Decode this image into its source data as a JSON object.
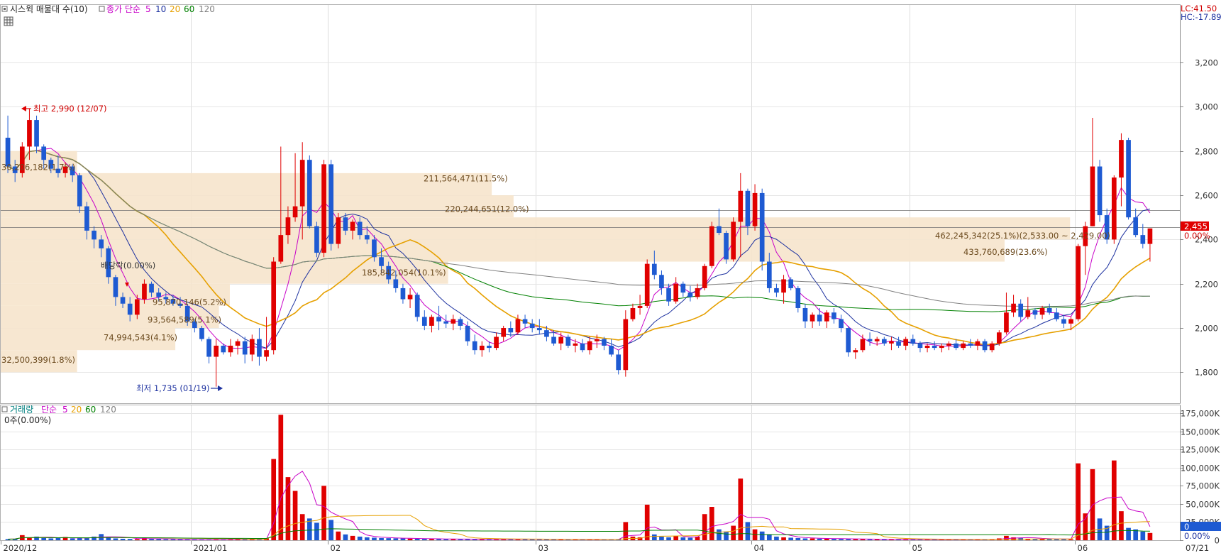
{
  "legend_price": {
    "indicator": "시스윅 매물대 수(10)",
    "ma_label": "종가 단순",
    "periods": [
      "5",
      "10",
      "20",
      "60",
      "120"
    ],
    "colors": [
      "#c800c8",
      "#1e32a0",
      "#e6a000",
      "#008000",
      "#808080"
    ]
  },
  "legend_volume": {
    "label": "거래량",
    "ma_label": "단순",
    "periods": [
      "5",
      "20",
      "60",
      "120"
    ],
    "colors": [
      "#c800c8",
      "#e6a000",
      "#008000",
      "#808080"
    ],
    "summary": "0주(0.00%)"
  },
  "corner": {
    "lc": "LC:41.50",
    "hc": "HC:-17.89"
  },
  "price_badge": {
    "value": "2,455",
    "pct": "0.00%"
  },
  "volume_badge": {
    "value": "0",
    "pct": "0.00%"
  },
  "annotations": {
    "high": "최고 2,990 (12/07)",
    "low": "최저 1,735 (01/19)",
    "dividend": "배당락(0.00%)"
  },
  "chart_data": {
    "type": "candlestick",
    "date_range": [
      "2020-12",
      "2021-07-21"
    ],
    "x_tick_labels": [
      "2020/12",
      "2021/01",
      "02",
      "03",
      "04",
      "05",
      "06",
      "07",
      "07/21"
    ],
    "price_axis": {
      "ylim": [
        1660,
        3460
      ],
      "ticks": [
        1800,
        2000,
        2200,
        2400,
        2600,
        2800,
        3000,
        3200
      ],
      "tick_labels": [
        "1,800",
        "2,000",
        "2,200",
        "2,400",
        "2,600",
        "2,800",
        "3,000",
        "3,200"
      ]
    },
    "volume_axis": {
      "ylim": [
        0,
        186000
      ],
      "ticks": [
        0,
        25000,
        50000,
        75000,
        100000,
        125000,
        150000,
        175000
      ],
      "tick_labels": [
        "0",
        "25,000K",
        "50,000K",
        "75,000K",
        "100,000K",
        "125,000K",
        "150,000K",
        "175,000K"
      ]
    },
    "volume_profile": [
      {
        "low": 1800,
        "high": 1900,
        "label": "32,500,399(1.8%)"
      },
      {
        "low": 1900,
        "high": 2000,
        "label": "74,994,543(4.1%)"
      },
      {
        "low": 2000,
        "high": 2100,
        "label": "93,564,589(5.1%)"
      },
      {
        "low": 2100,
        "high": 2200,
        "label": "95,870,146(5.2%)"
      },
      {
        "low": 2200,
        "high": 2300,
        "label": "185,842,054(10.1%)"
      },
      {
        "low": 2300,
        "high": 2400,
        "label": "433,760,689(23.6%)"
      },
      {
        "low": 2400,
        "high": 2500,
        "label": "462,245,342(25.1%)(2,533.00 ~ 2,429.00)"
      },
      {
        "low": 2500,
        "high": 2600,
        "label": "220,244,651(12.0%)"
      },
      {
        "low": 2600,
        "high": 2700,
        "label": "211,564,471(11.5%)"
      },
      {
        "low": 2700,
        "high": 2800,
        "label": "30,206,182(1.7%)"
      }
    ],
    "reference_lines": [
      2455,
      2533
    ],
    "candles": [
      [
        2860,
        2960,
        2700,
        2730,
        1500
      ],
      [
        2730,
        2760,
        2660,
        2700,
        2000
      ],
      [
        2700,
        2840,
        2680,
        2820,
        7000
      ],
      [
        2820,
        2990,
        2760,
        2940,
        3500
      ],
      [
        2940,
        2960,
        2790,
        2820,
        5000
      ],
      [
        2820,
        2830,
        2720,
        2760,
        3000
      ],
      [
        2760,
        2770,
        2700,
        2720,
        2500
      ],
      [
        2720,
        2780,
        2680,
        2700,
        3000
      ],
      [
        2700,
        2750,
        2680,
        2730,
        4500
      ],
      [
        2730,
        2740,
        2660,
        2690,
        2500
      ],
      [
        2690,
        2700,
        2520,
        2550,
        3000
      ],
      [
        2550,
        2570,
        2400,
        2440,
        3000
      ],
      [
        2440,
        2460,
        2360,
        2400,
        5000
      ],
      [
        2400,
        2420,
        2320,
        2360,
        8500
      ],
      [
        2360,
        2370,
        2200,
        2230,
        4000
      ],
      [
        2230,
        2240,
        2100,
        2140,
        2500
      ],
      [
        2140,
        2160,
        2090,
        2110,
        2000
      ],
      [
        2110,
        2140,
        2030,
        2060,
        1800
      ],
      [
        2060,
        2150,
        2040,
        2130,
        1500
      ],
      [
        2130,
        2220,
        2110,
        2200,
        3000
      ],
      [
        2200,
        2210,
        2140,
        2160,
        2000
      ],
      [
        2160,
        2180,
        2120,
        2140,
        1500
      ],
      [
        2140,
        2160,
        2110,
        2130,
        1200
      ],
      [
        2130,
        2150,
        2100,
        2110,
        1200
      ],
      [
        2110,
        2140,
        2090,
        2100,
        1000
      ],
      [
        2100,
        2110,
        2010,
        2030,
        900
      ],
      [
        2030,
        2040,
        1980,
        2000,
        900
      ],
      [
        2000,
        2010,
        1940,
        1950,
        800
      ],
      [
        1950,
        1960,
        1840,
        1870,
        900
      ],
      [
        1870,
        1950,
        1735,
        1920,
        1200
      ],
      [
        1920,
        1930,
        1880,
        1890,
        800
      ],
      [
        1890,
        1950,
        1870,
        1920,
        1500
      ],
      [
        1920,
        1950,
        1880,
        1940,
        1300
      ],
      [
        1940,
        1960,
        1840,
        1880,
        1000
      ],
      [
        1880,
        1970,
        1850,
        1950,
        1200
      ],
      [
        1950,
        2000,
        1830,
        1870,
        1500
      ],
      [
        1870,
        2050,
        1850,
        1900,
        2500
      ],
      [
        1900,
        2320,
        1880,
        2300,
        112000
      ],
      [
        2300,
        2820,
        2290,
        2420,
        173000
      ],
      [
        2420,
        2550,
        2380,
        2500,
        87000
      ],
      [
        2500,
        2790,
        2480,
        2550,
        68000
      ],
      [
        2550,
        2840,
        2400,
        2760,
        36000
      ],
      [
        2760,
        2780,
        2450,
        2460,
        30000
      ],
      [
        2460,
        2480,
        2320,
        2340,
        24000
      ],
      [
        2340,
        2760,
        2320,
        2740,
        75000
      ],
      [
        2740,
        2760,
        2350,
        2380,
        28000
      ],
      [
        2380,
        2520,
        2360,
        2500,
        12000
      ],
      [
        2500,
        2520,
        2420,
        2440,
        8000
      ],
      [
        2440,
        2490,
        2400,
        2480,
        6000
      ],
      [
        2480,
        2500,
        2400,
        2420,
        5000
      ],
      [
        2420,
        2460,
        2380,
        2400,
        4000
      ],
      [
        2400,
        2420,
        2300,
        2320,
        3500
      ],
      [
        2320,
        2360,
        2250,
        2280,
        3000
      ],
      [
        2280,
        2300,
        2200,
        2220,
        2800
      ],
      [
        2220,
        2260,
        2160,
        2180,
        2600
      ],
      [
        2180,
        2200,
        2110,
        2130,
        2400
      ],
      [
        2130,
        2180,
        2090,
        2150,
        2200
      ],
      [
        2150,
        2160,
        2030,
        2050,
        2000
      ],
      [
        2050,
        2080,
        1990,
        2010,
        1900
      ],
      [
        2010,
        2060,
        1980,
        2050,
        1800
      ],
      [
        2050,
        2100,
        1990,
        2030,
        1700
      ],
      [
        2030,
        2060,
        2000,
        2020,
        1600
      ],
      [
        2020,
        2060,
        1990,
        2040,
        1500
      ],
      [
        2040,
        2050,
        1990,
        2010,
        1400
      ],
      [
        2010,
        2030,
        1920,
        1940,
        1500
      ],
      [
        1940,
        1970,
        1880,
        1900,
        1300
      ],
      [
        1900,
        1940,
        1870,
        1920,
        1200
      ],
      [
        1920,
        1940,
        1890,
        1910,
        1100
      ],
      [
        1910,
        1980,
        1900,
        1960,
        1200
      ],
      [
        1960,
        2010,
        1940,
        2000,
        1400
      ],
      [
        2000,
        2030,
        1960,
        1980,
        1300
      ],
      [
        1980,
        2060,
        1970,
        2040,
        1500
      ],
      [
        2040,
        2060,
        2000,
        2020,
        1300
      ],
      [
        2020,
        2040,
        1980,
        2000,
        1200
      ],
      [
        2000,
        2040,
        1970,
        1990,
        1100
      ],
      [
        1990,
        2010,
        1940,
        1960,
        1000
      ],
      [
        1960,
        1990,
        1920,
        1930,
        1000
      ],
      [
        1930,
        1980,
        1900,
        1960,
        1000
      ],
      [
        1960,
        1970,
        1910,
        1920,
        900
      ],
      [
        1920,
        1950,
        1890,
        1930,
        900
      ],
      [
        1930,
        1950,
        1890,
        1900,
        800
      ],
      [
        1900,
        1960,
        1880,
        1940,
        900
      ],
      [
        1940,
        1970,
        1910,
        1950,
        900
      ],
      [
        1950,
        1960,
        1900,
        1920,
        800
      ],
      [
        1920,
        1950,
        1870,
        1880,
        900
      ],
      [
        1880,
        1900,
        1790,
        1810,
        1200
      ],
      [
        1810,
        2080,
        1780,
        2040,
        25000
      ],
      [
        2040,
        2110,
        2030,
        2090,
        5000
      ],
      [
        2090,
        2150,
        2060,
        2100,
        4000
      ],
      [
        2100,
        2310,
        2090,
        2290,
        49000
      ],
      [
        2290,
        2350,
        2220,
        2240,
        8000
      ],
      [
        2240,
        2260,
        2150,
        2180,
        5000
      ],
      [
        2180,
        2200,
        2100,
        2120,
        4000
      ],
      [
        2120,
        2230,
        2110,
        2200,
        6000
      ],
      [
        2200,
        2210,
        2140,
        2160,
        4000
      ],
      [
        2160,
        2190,
        2120,
        2140,
        3500
      ],
      [
        2140,
        2200,
        2130,
        2180,
        5000
      ],
      [
        2180,
        2290,
        2170,
        2280,
        36000
      ],
      [
        2280,
        2480,
        2270,
        2460,
        46000
      ],
      [
        2460,
        2540,
        2420,
        2430,
        15000
      ],
      [
        2430,
        2440,
        2290,
        2310,
        12000
      ],
      [
        2310,
        2500,
        2300,
        2480,
        20000
      ],
      [
        2480,
        2700,
        2320,
        2620,
        85000
      ],
      [
        2620,
        2630,
        2420,
        2460,
        25000
      ],
      [
        2460,
        2650,
        2440,
        2610,
        15000
      ],
      [
        2610,
        2630,
        2260,
        2300,
        12000
      ],
      [
        2300,
        2340,
        2160,
        2180,
        8000
      ],
      [
        2180,
        2200,
        2140,
        2160,
        5000
      ],
      [
        2160,
        2240,
        2110,
        2220,
        4000
      ],
      [
        2220,
        2230,
        2170,
        2180,
        3500
      ],
      [
        2180,
        2190,
        2070,
        2090,
        3000
      ],
      [
        2090,
        2110,
        2000,
        2030,
        2500
      ],
      [
        2030,
        2070,
        2000,
        2060,
        2500
      ],
      [
        2060,
        2090,
        2010,
        2030,
        2200
      ],
      [
        2030,
        2080,
        2000,
        2070,
        2200
      ],
      [
        2070,
        2090,
        2020,
        2040,
        2000
      ],
      [
        2040,
        2060,
        1980,
        2000,
        1800
      ],
      [
        2000,
        2010,
        1870,
        1890,
        1800
      ],
      [
        1890,
        1910,
        1860,
        1900,
        1500
      ],
      [
        1900,
        1970,
        1890,
        1950,
        1500
      ],
      [
        1950,
        1980,
        1920,
        1940,
        1400
      ],
      [
        1940,
        1960,
        1920,
        1950,
        1300
      ],
      [
        1950,
        1960,
        1920,
        1930,
        1200
      ],
      [
        1930,
        1960,
        1900,
        1940,
        1200
      ],
      [
        1940,
        1960,
        1910,
        1920,
        1100
      ],
      [
        1920,
        1960,
        1900,
        1950,
        1100
      ],
      [
        1950,
        1970,
        1920,
        1930,
        1000
      ],
      [
        1930,
        1940,
        1890,
        1910,
        1000
      ],
      [
        1910,
        1930,
        1890,
        1920,
        900
      ],
      [
        1920,
        1940,
        1900,
        1910,
        900
      ],
      [
        1910,
        1930,
        1890,
        1920,
        800
      ],
      [
        1920,
        1940,
        1900,
        1930,
        900
      ],
      [
        1930,
        1950,
        1900,
        1910,
        800
      ],
      [
        1910,
        1940,
        1900,
        1930,
        900
      ],
      [
        1930,
        1950,
        1910,
        1920,
        800
      ],
      [
        1920,
        1950,
        1900,
        1940,
        900
      ],
      [
        1940,
        1950,
        1890,
        1900,
        1000
      ],
      [
        1900,
        1940,
        1890,
        1930,
        1200
      ],
      [
        1930,
        1990,
        1920,
        1980,
        2500
      ],
      [
        1980,
        2160,
        1970,
        2070,
        6000
      ],
      [
        2070,
        2150,
        2050,
        2110,
        4000
      ],
      [
        2110,
        2130,
        2030,
        2050,
        3000
      ],
      [
        2050,
        2140,
        2040,
        2080,
        2000
      ],
      [
        2080,
        2090,
        2040,
        2060,
        1800
      ],
      [
        2060,
        2100,
        2040,
        2090,
        1800
      ],
      [
        2090,
        2110,
        2060,
        2070,
        1600
      ],
      [
        2070,
        2090,
        2030,
        2040,
        1500
      ],
      [
        2040,
        2060,
        2000,
        2020,
        1400
      ],
      [
        2020,
        2050,
        1990,
        2040,
        1300
      ],
      [
        2040,
        2380,
        2030,
        2370,
        106000
      ],
      [
        2370,
        2480,
        2240,
        2460,
        37000
      ],
      [
        2460,
        2950,
        2460,
        2730,
        98000
      ],
      [
        2730,
        2760,
        2480,
        2510,
        30000
      ],
      [
        2510,
        2540,
        2380,
        2400,
        20000
      ],
      [
        2400,
        2690,
        2380,
        2680,
        110000
      ],
      [
        2680,
        2880,
        2550,
        2850,
        40000
      ],
      [
        2850,
        2860,
        2490,
        2500,
        17000
      ],
      [
        2500,
        2540,
        2410,
        2420,
        15000
      ],
      [
        2420,
        2470,
        2360,
        2380,
        12000
      ],
      [
        2380,
        2450,
        2300,
        2450,
        10000
      ]
    ],
    "moving_averages": [
      {
        "period": 5,
        "color": "#c800c8"
      },
      {
        "period": 10,
        "color": "#1e32a0"
      },
      {
        "period": 20,
        "color": "#e6a000"
      },
      {
        "period": 60,
        "color": "#008000"
      },
      {
        "period": 120,
        "color": "#808080"
      }
    ],
    "volume_moving_averages": [
      {
        "period": 5,
        "color": "#c800c8"
      },
      {
        "period": 20,
        "color": "#e6a000"
      },
      {
        "period": 60,
        "color": "#008000"
      }
    ],
    "up_color": "#e00000",
    "down_color": "#1e5ad2"
  }
}
